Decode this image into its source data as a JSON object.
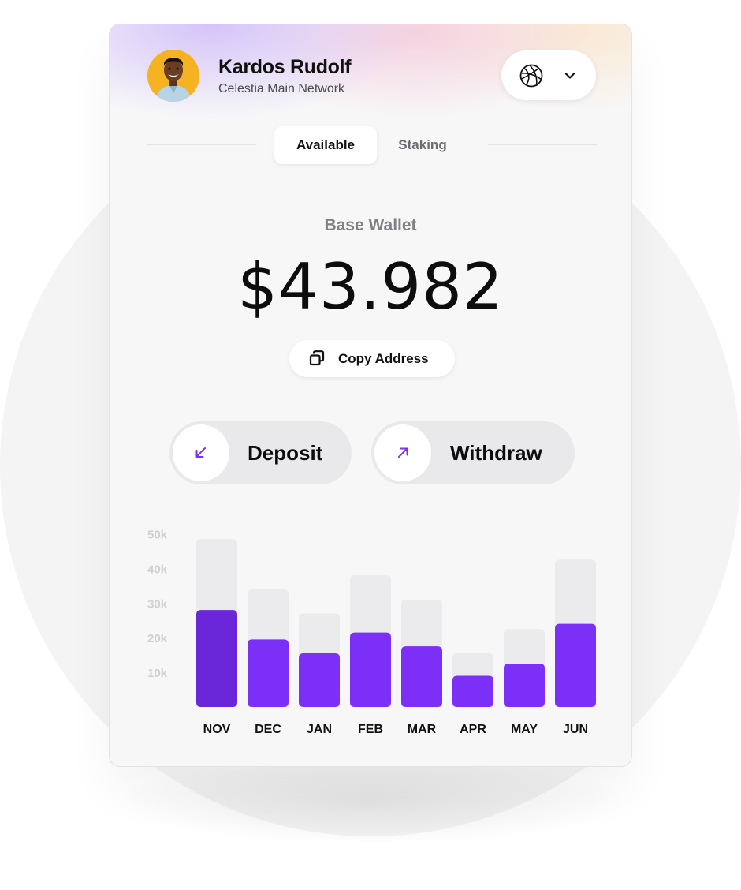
{
  "user": {
    "name": "Kardos Rudolf",
    "network": "Celestia Main Network"
  },
  "network_select": {
    "icon": "globe-icon",
    "dropdown_icon": "chevron-down-icon"
  },
  "tabs": [
    {
      "label": "Available",
      "active": true
    },
    {
      "label": "Staking",
      "active": false
    }
  ],
  "wallet": {
    "label": "Base Wallet",
    "balance": "$43.982",
    "copy_label": "Copy Address"
  },
  "actions": {
    "deposit_label": "Deposit",
    "withdraw_label": "Withdraw"
  },
  "colors": {
    "accent": "#7b2ff7",
    "accent_dark": "#6a26d9",
    "bar_track": "#ebebed",
    "avatar_bg": "#f5b324"
  },
  "chart_data": {
    "type": "bar",
    "categories": [
      "NOV",
      "DEC",
      "JAN",
      "FEB",
      "MAR",
      "APR",
      "MAY",
      "JUN"
    ],
    "series": [
      {
        "values": [
          48.5,
          34,
          27,
          38,
          31,
          15.5,
          22.5,
          42.5
        ]
      },
      {
        "values": [
          28,
          19.5,
          15.5,
          21.5,
          17.5,
          9,
          12.5,
          24
        ]
      }
    ],
    "y_ticks": [
      "50k",
      "40k",
      "30k",
      "20k",
      "10k"
    ],
    "y_tick_values": [
      50,
      40,
      30,
      20,
      10
    ],
    "highlighted_category": "NOV",
    "grid": false,
    "legend": false
  }
}
